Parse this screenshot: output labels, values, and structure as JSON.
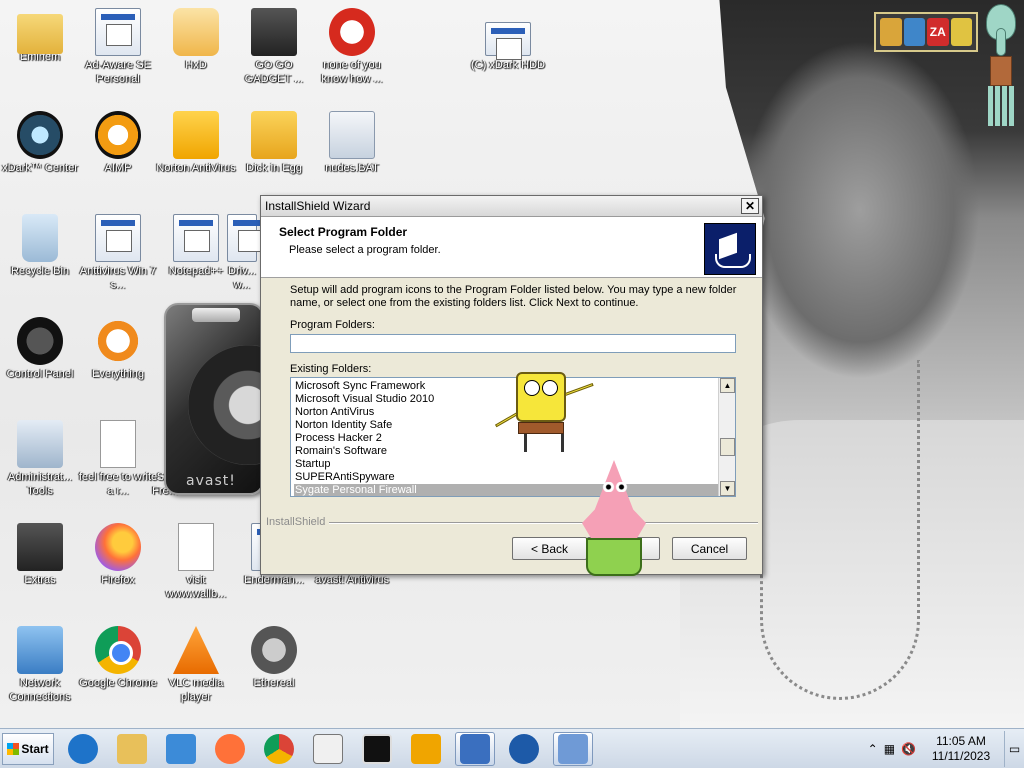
{
  "desktop_icons": [
    {
      "label": "Eminem",
      "icon": "user-folder-icon"
    },
    {
      "label": "Ad-Aware SE Personal",
      "icon": "generic-app-icon"
    },
    {
      "label": "HxD",
      "icon": "hxd-icon"
    },
    {
      "label": "GO GO GADGET ...",
      "icon": "gadget-icon"
    },
    {
      "label": "none of you know how ...",
      "icon": "red-circle-icon"
    },
    {
      "label": "(C) xDark HDD",
      "icon": "generic-app-icon"
    },
    {
      "label": "xDark™ Center",
      "icon": "xdark-icon"
    },
    {
      "label": "AIMP",
      "icon": "aimp-icon"
    },
    {
      "label": "Norton AntiVirus",
      "icon": "norton-icon"
    },
    {
      "label": "Dick in Egg",
      "icon": "egg-icon"
    },
    {
      "label": "nudes.BAT",
      "icon": "batch-file-icon"
    },
    {
      "label": "Recycle Bin",
      "icon": "recycle-bin-icon"
    },
    {
      "label": "Anttivirus Win 7 s...",
      "icon": "generic-app-icon"
    },
    {
      "label": "Notepad++",
      "icon": "notepad-icon"
    },
    {
      "label": "Driv... w...",
      "icon": "generic-app-icon"
    },
    {
      "label": "Control Panel",
      "icon": "control-panel-icon"
    },
    {
      "label": "Everything",
      "icon": "search-icon"
    },
    {
      "label": "Administrat... Tools",
      "icon": "admin-tools-icon"
    },
    {
      "label": "feel free to write a r...",
      "icon": "text-file-icon"
    },
    {
      "label": "S... Fre...",
      "icon": "generic-app-icon"
    },
    {
      "label": "Extras",
      "icon": "folder-icon"
    },
    {
      "label": "Firefox",
      "icon": "firefox-icon"
    },
    {
      "label": "visit www.wallb...",
      "icon": "text-file-icon"
    },
    {
      "label": "Enderman...",
      "icon": "generic-app-icon"
    },
    {
      "label": "avast! Antivirus",
      "icon": "avast-icon"
    },
    {
      "label": "Network Connections",
      "icon": "network-icon"
    },
    {
      "label": "Google Chrome",
      "icon": "chrome-icon"
    },
    {
      "label": "VLC media player",
      "icon": "vlc-icon"
    },
    {
      "label": "Ethereal",
      "icon": "ethereal-icon"
    }
  ],
  "gadgets": {
    "avast_brand": "avast!",
    "top_gadget": [
      "",
      "",
      "ZA",
      ""
    ]
  },
  "dialog": {
    "title": "InstallShield Wizard",
    "close_label": "✕",
    "header_title": "Select Program Folder",
    "header_subtitle": "Please select a program folder.",
    "description": "Setup will add program icons to the Program Folder listed below.  You may type a new folder name, or select one from the existing folders list.  Click Next to continue.",
    "program_folders_label": "Program Folders:",
    "program_folders_value": "",
    "existing_folders_label": "Existing Folders:",
    "existing_folders": [
      "Microsoft Sync Framework",
      "Microsoft Visual Studio 2010",
      "Norton AntiVirus",
      "Norton Identity Safe",
      "Process Hacker 2",
      "Romain's Software",
      "Startup",
      "SUPERAntiSpyware",
      "Sygate Personal Firewall"
    ],
    "selected_folder": "Sygate Personal Firewall",
    "brand": "InstallShield",
    "back_label": "< Back",
    "next_label": "Next >",
    "cancel_label": "Cancel"
  },
  "taskbar": {
    "start_label": "Start",
    "items": [
      {
        "name": "internet-explorer-icon",
        "color": "#1e73c9"
      },
      {
        "name": "file-explorer-icon",
        "color": "#e8c05a"
      },
      {
        "name": "media-player-icon",
        "color": "#3c8bd8"
      },
      {
        "name": "firefox-icon",
        "color": "#ff7139"
      },
      {
        "name": "chrome-icon",
        "color": "#4285f4"
      },
      {
        "name": "folder-icon",
        "color": "#f0f0f0"
      },
      {
        "name": "7zip-icon",
        "color": "#111111"
      },
      {
        "name": "norton-icon",
        "color": "#f0a500"
      },
      {
        "name": "window-app-icon",
        "color": "#3a6fbf"
      },
      {
        "name": "superantispyware-icon",
        "color": "#1d5aa8"
      },
      {
        "name": "installshield-icon",
        "color": "#6f9ad6"
      }
    ],
    "clock_time": "11:05 AM",
    "clock_date": "11/11/2023"
  }
}
